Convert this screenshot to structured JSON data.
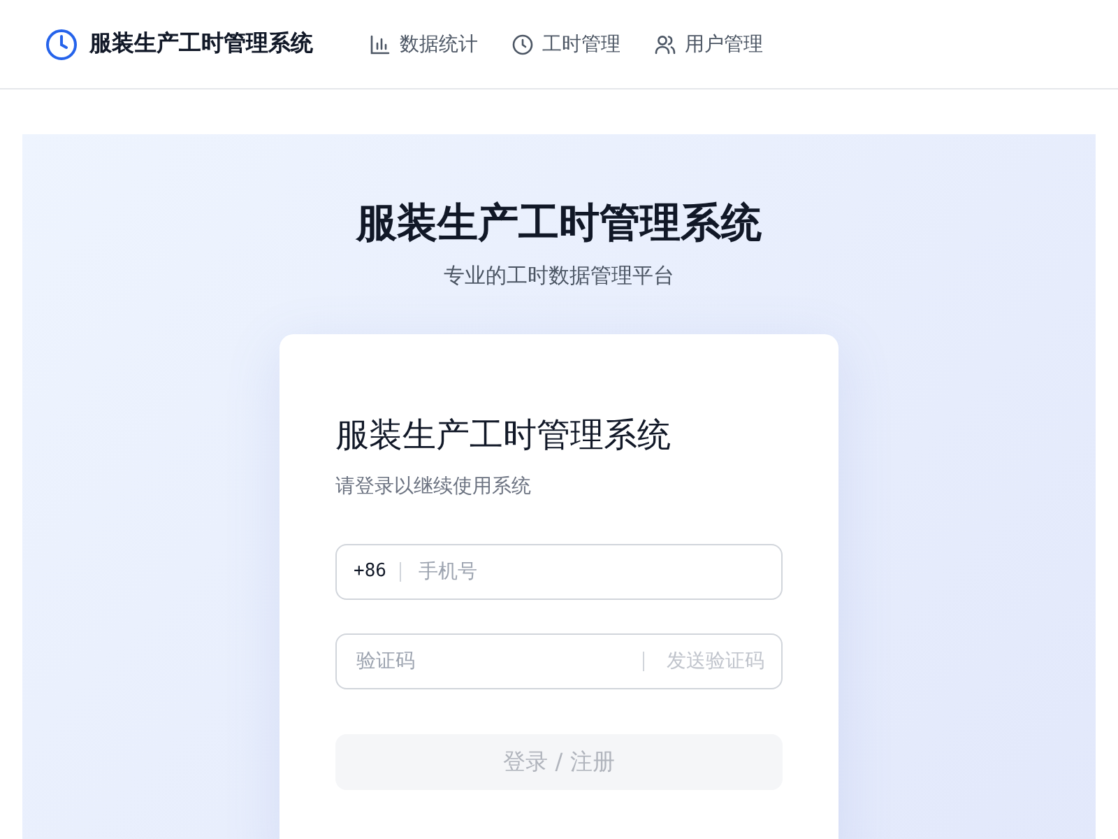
{
  "header": {
    "brand": "服装生产工时管理系统",
    "nav": [
      {
        "label": "数据统计",
        "kind": "chart"
      },
      {
        "label": "工时管理",
        "kind": "clock"
      },
      {
        "label": "用户管理",
        "kind": "users"
      }
    ]
  },
  "hero": {
    "title": "服装生产工时管理系统",
    "subtitle": "专业的工时数据管理平台"
  },
  "login": {
    "title": "服装生产工时管理系统",
    "subtitle": "请登录以继续使用系统",
    "phone": {
      "prefix": "+86",
      "placeholder": "手机号"
    },
    "code": {
      "placeholder": "验证码",
      "send_label": "发送验证码",
      "send_disabled": true
    },
    "submit": {
      "label": "登录 / 注册",
      "disabled": true
    }
  }
}
